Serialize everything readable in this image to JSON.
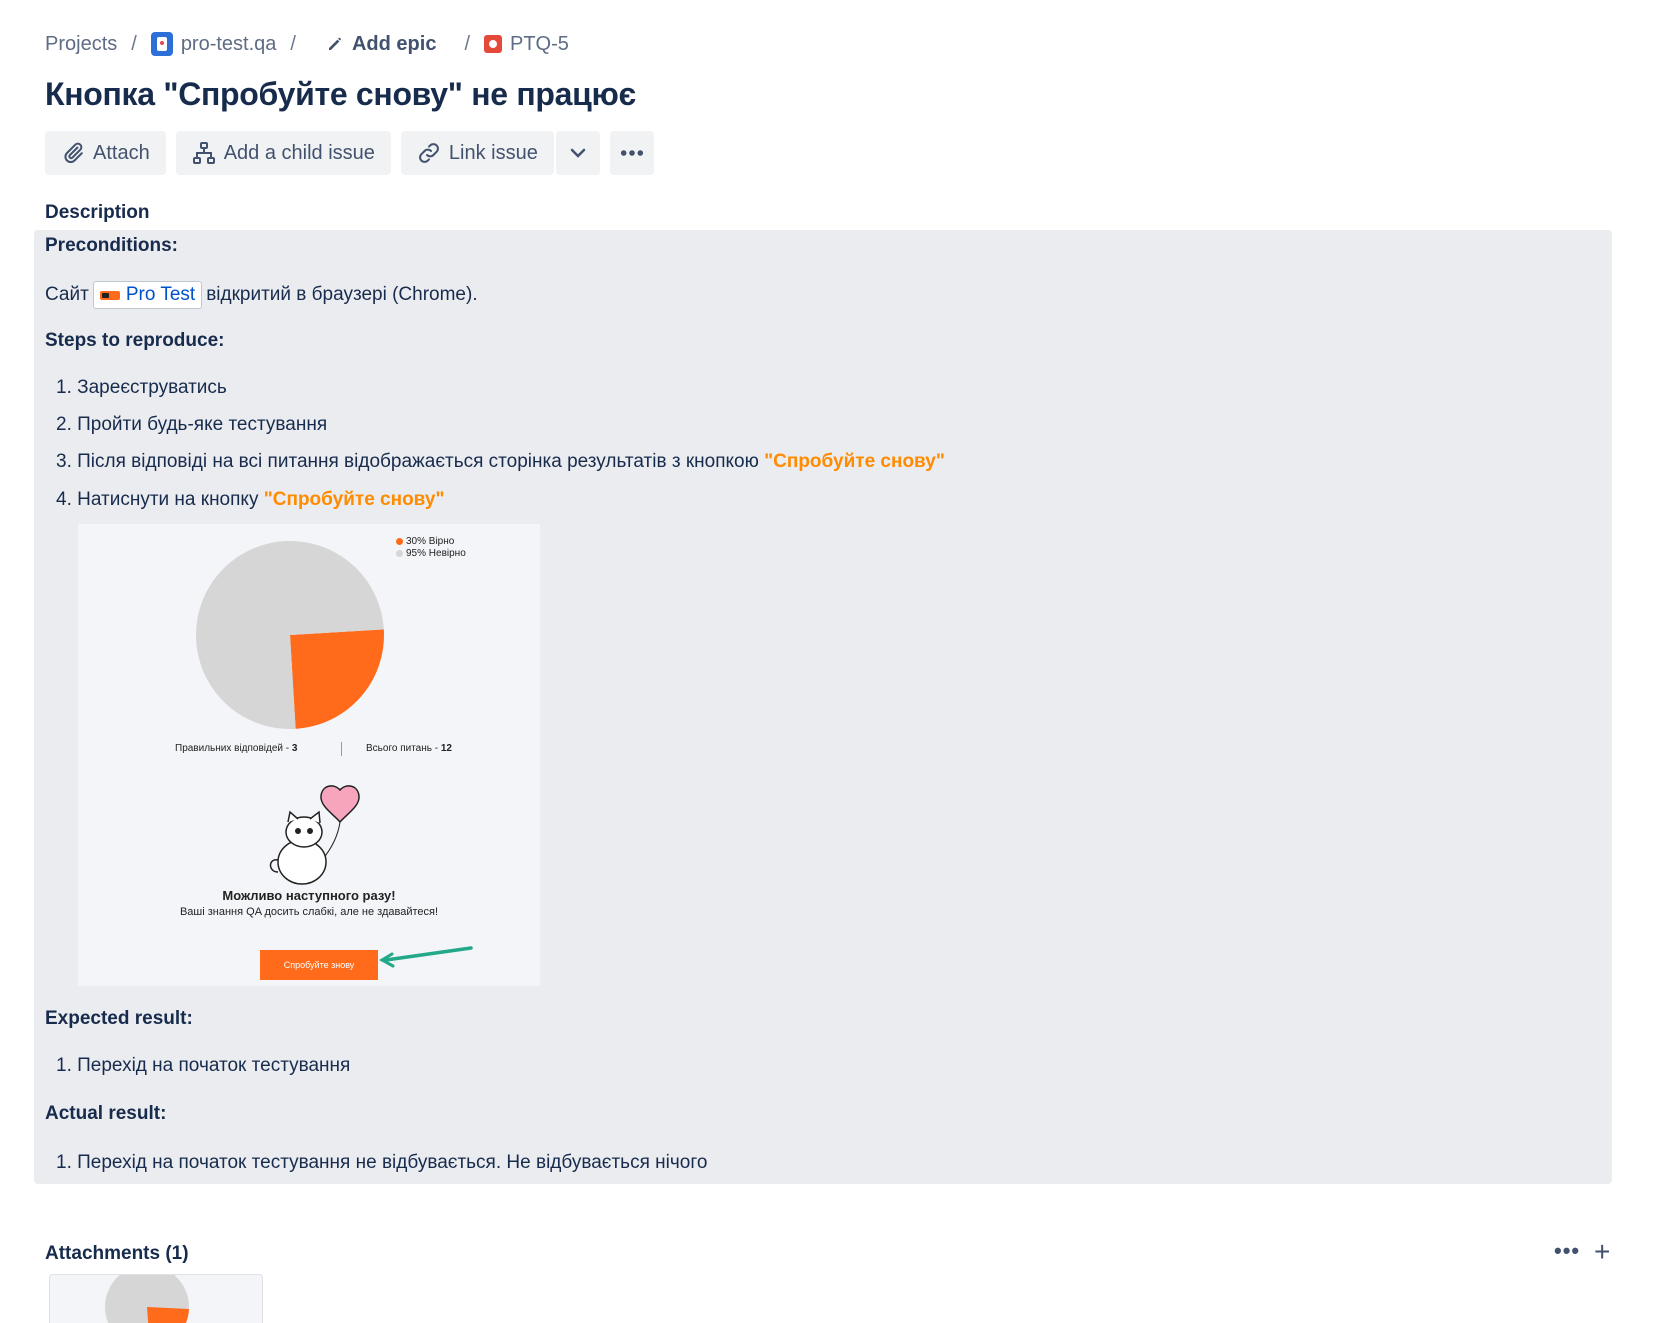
{
  "breadcrumb": {
    "projects": "Projects",
    "separator": "/",
    "project": "pro-test.qa",
    "add_epic": "Add epic",
    "issue_key": "PTQ-5"
  },
  "title": "Кнопка \"Спробуйте снову\" не працює",
  "toolbar": {
    "attach": "Attach",
    "add_child": "Add a child issue",
    "link_issue": "Link issue"
  },
  "description": {
    "heading": "Description",
    "preconditions_label": "Preconditions:",
    "site_prefix": "Сайт",
    "site_link": "Pro Test",
    "site_suffix": "відкритий в браузері (Chrome).",
    "steps_label": "Steps to reproduce:",
    "steps": [
      {
        "num": "1.",
        "text": "Зареєструватись",
        "highlight": ""
      },
      {
        "num": "2.",
        "text": "Пройти будь-яке тестування",
        "highlight": ""
      },
      {
        "num": "3.",
        "text": "Після відповіді на всі питання відображається сторінка результатів з кнопкою",
        "highlight": "\"Спробуйте снову\""
      },
      {
        "num": "4.",
        "text": "Натиснути на кнопку",
        "highlight": "\"Спробуйте снову\""
      }
    ],
    "expected_label": "Expected result:",
    "expected": [
      {
        "num": "1.",
        "text": "Перехід на початок тестування"
      }
    ],
    "actual_label": "Actual result:",
    "actual": [
      {
        "num": "1.",
        "text": "Перехід на початок тестування не відбувається. Не відбувається нічого"
      }
    ]
  },
  "embedded_screenshot": {
    "legend": [
      "30% Вірно",
      "95% Невірно"
    ],
    "correct_label": "Правильних відповідей - ",
    "correct_value": "3",
    "total_label": "Всього питань - ",
    "total_value": "12",
    "heading": "Можливо наступного разу!",
    "subheading": "Ваші знання QA досить слабкі, але не здавайтеся!",
    "button": "Спробуйте знову",
    "colors": {
      "correct": "#ff6b1a",
      "wrong": "#d6d6d6"
    }
  },
  "chart_data": {
    "type": "pie",
    "labels": [
      "30% Вірно",
      "95% Невірно"
    ],
    "values": [
      25,
      75
    ],
    "legend": "top-right"
  },
  "attachments": {
    "heading": "Attachments (1)",
    "more": "•••",
    "add": "+"
  }
}
